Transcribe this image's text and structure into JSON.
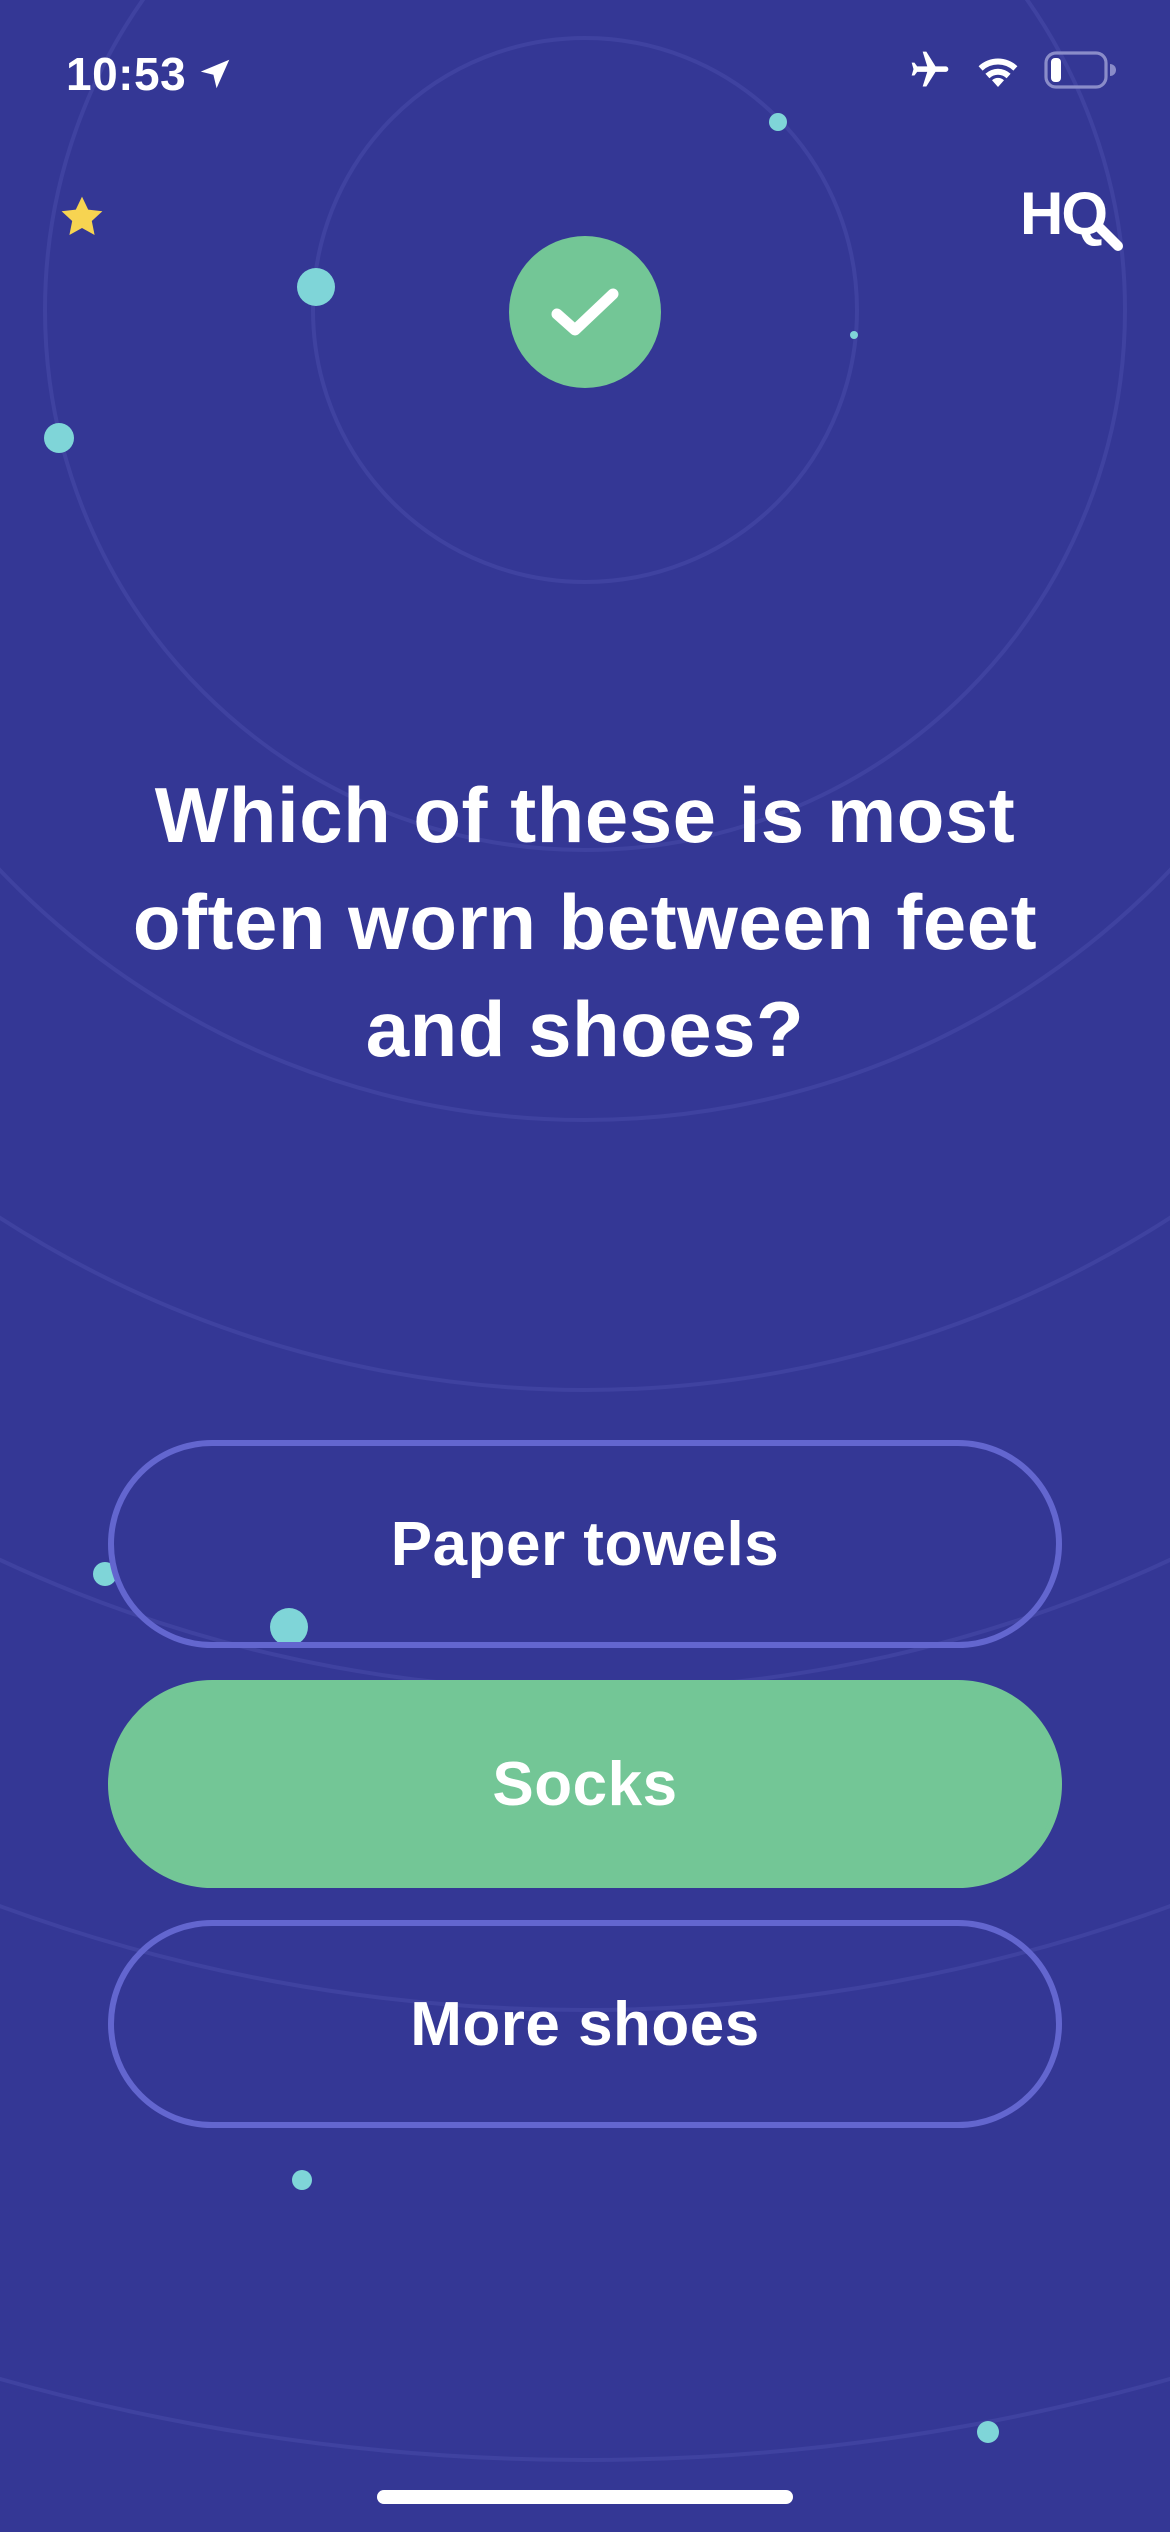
{
  "status_bar": {
    "time": "10:53",
    "location_icon": "location-arrow-icon",
    "airplane_icon": "airplane-icon",
    "wifi_icon": "wifi-icon",
    "battery_icon": "battery-low-icon"
  },
  "header": {
    "star_icon": "star-icon",
    "logo_text": "HQ",
    "result_icon": "checkmark-icon"
  },
  "question": {
    "text": "Which of these is most often worn between feet and shoes?"
  },
  "answers": [
    {
      "label": "Paper towels",
      "state": "unselected"
    },
    {
      "label": "Socks",
      "state": "correct"
    },
    {
      "label": "More shoes",
      "state": "unselected"
    }
  ],
  "colors": {
    "background": "#343795",
    "correct": "#73c696",
    "outline": "#6366cf",
    "dot": "#7fd5d8",
    "star": "#f7d451",
    "text": "#ffffff"
  }
}
